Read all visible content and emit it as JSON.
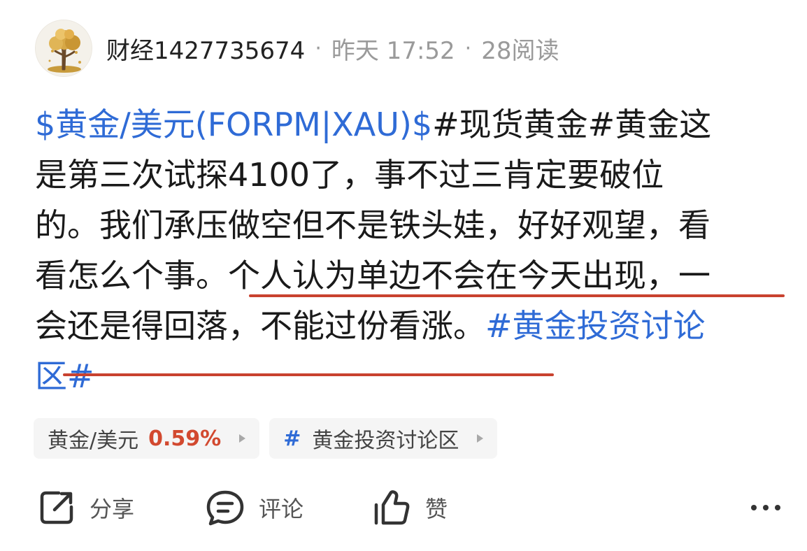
{
  "header": {
    "author": "财经1427735674",
    "separator": "·",
    "time": "昨天 17:52",
    "reads": "28阅读"
  },
  "post": {
    "lines": [
      [
        {
          "text": "$黄金/美元(FORPM|XAU)$",
          "type": "link"
        },
        {
          "text": "#现货黄金#黄金这",
          "type": "text"
        }
      ],
      [
        {
          "text": "是第三次试探4100了，事不过三肯定要破位",
          "type": "text"
        }
      ],
      [
        {
          "text": "的。我们承压做空但不是铁头娃，好好观望，看",
          "type": "text"
        }
      ],
      [
        {
          "text": "看怎么个事。",
          "type": "text"
        },
        {
          "text": "个人认为单边不会在今天出现，一",
          "type": "text"
        }
      ],
      [
        {
          "text": "会还是得回落，不能过份看涨。",
          "type": "text"
        },
        {
          "text": "#黄金投资讨论",
          "type": "link"
        }
      ],
      [
        {
          "text": "区#",
          "type": "link"
        }
      ]
    ]
  },
  "chips": {
    "stock": {
      "name": "黄金/美元",
      "change": "0.59%",
      "change_color": "#d2492f"
    },
    "topic": {
      "hash": "#",
      "name": "黄金投资讨论区"
    }
  },
  "actions": {
    "share": "分享",
    "comment": "评论",
    "like": "赞"
  },
  "colors": {
    "link": "#2f6bd6",
    "underline_annotation": "#c9422f"
  },
  "icons": [
    "avatar-tree",
    "share-icon",
    "comment-icon",
    "thumbs-up-icon",
    "chevron-right-icon",
    "more-icon"
  ]
}
